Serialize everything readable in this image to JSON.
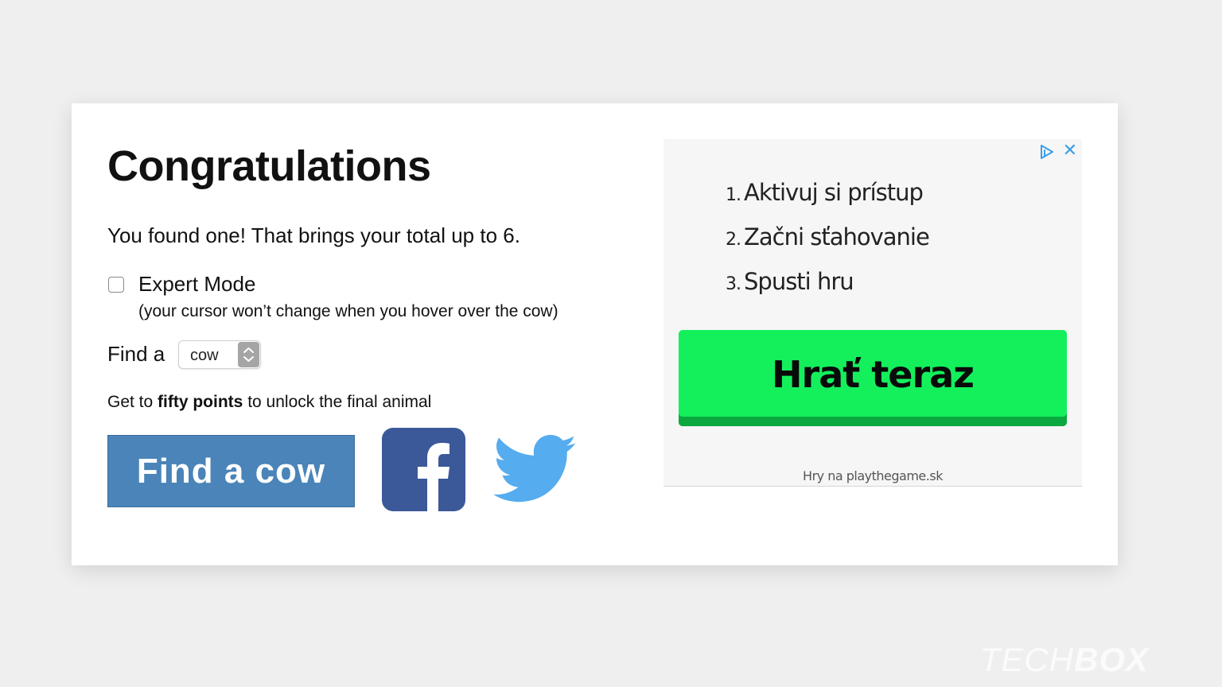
{
  "dialog": {
    "title": "Congratulations",
    "found_text": "You found one! That brings your total up to 6.",
    "expert_mode": {
      "label": "Expert Mode",
      "note": "(your cursor won’t change when you hover over the cow)",
      "checked": false
    },
    "find_label": "Find a",
    "animal_select": {
      "value": "cow"
    },
    "unlock": {
      "prefix": "Get to ",
      "bold": "fifty points",
      "suffix": " to unlock the final animal"
    },
    "find_button_label": "Find a cow",
    "share": {
      "facebook_icon": "facebook-icon",
      "twitter_icon": "twitter-icon",
      "facebook_color": "#3b5998",
      "twitter_color": "#55acee"
    }
  },
  "ad": {
    "steps": [
      {
        "num": "1.",
        "text": "Aktivuj si prístup"
      },
      {
        "num": "2.",
        "text": "Začni sťahovanie"
      },
      {
        "num": "3.",
        "text": "Spusti hru"
      }
    ],
    "play_button": "Hrať teraz",
    "footer": "Hry na playthegame.sk",
    "choices_icon": "adchoices-icon",
    "close_icon": "close-icon",
    "button_color": "#13f05c"
  },
  "watermark": {
    "light": "TECH",
    "bold": "BOX"
  },
  "colors": {
    "accent": "#4a84b8",
    "background": "#efefef"
  }
}
